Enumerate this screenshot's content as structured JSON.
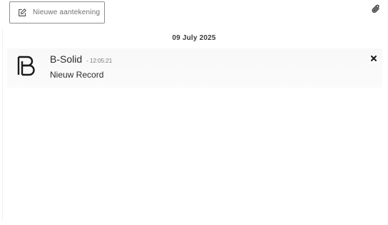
{
  "toolbar": {
    "new_button_label": "Nieuwe aantekening",
    "new_button_icon": "edit-icon",
    "attach_icon": "paperclip-icon"
  },
  "feed": {
    "date_heading": "09 July 2025",
    "notifications": [
      {
        "sender": "B-Solid",
        "time": "- 12:05:21",
        "message": "Nieuw Record",
        "logo_icon": "b-solid-logo",
        "close_icon": "close-icon"
      }
    ]
  }
}
